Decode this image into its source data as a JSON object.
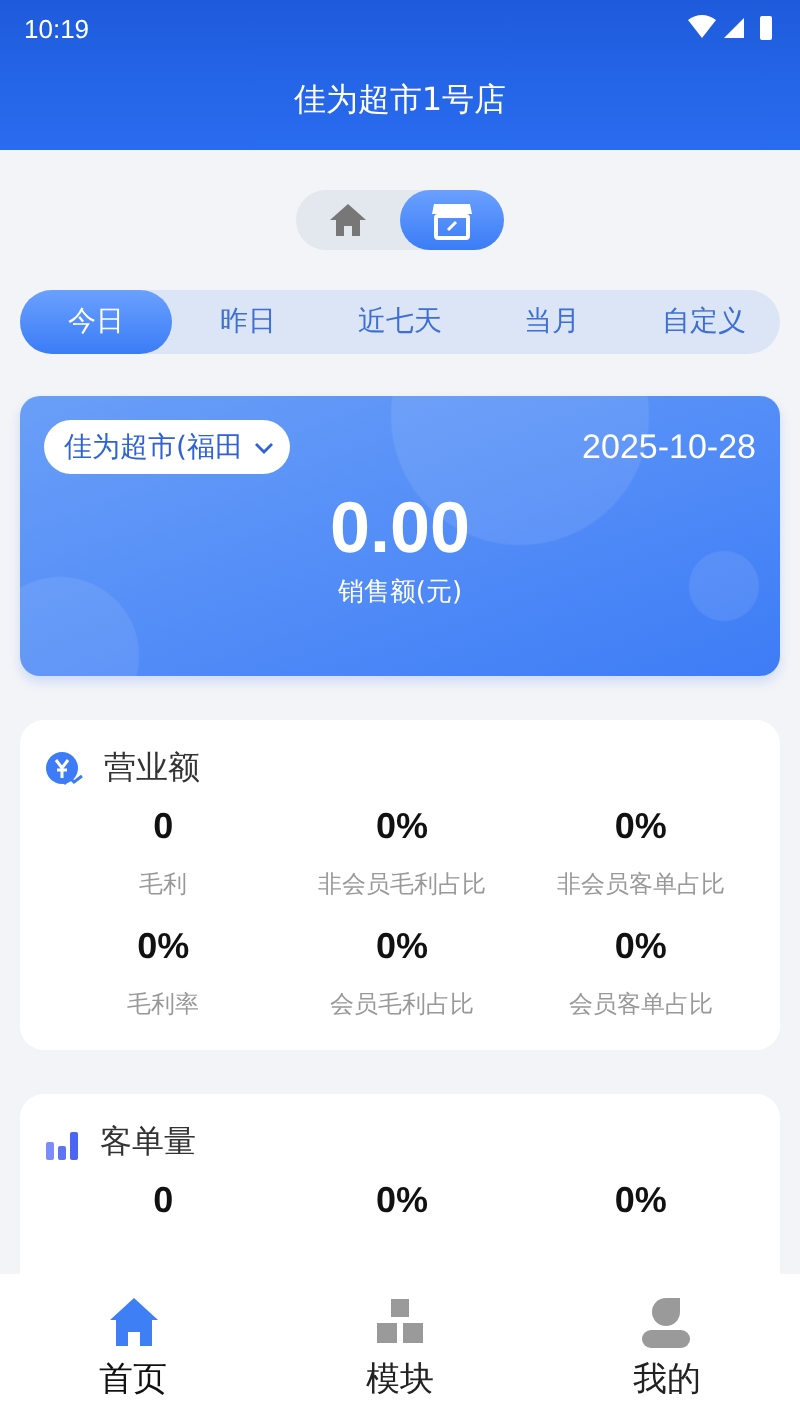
{
  "status_bar": {
    "time": "10:19"
  },
  "header": {
    "title": "佳为超市1号店"
  },
  "view_toggle": [
    {
      "kind": "home",
      "selected": false
    },
    {
      "kind": "store",
      "selected": true
    }
  ],
  "period_tabs": [
    {
      "label": "今日",
      "selected": true
    },
    {
      "label": "昨日",
      "selected": false
    },
    {
      "label": "近七天",
      "selected": false
    },
    {
      "label": "当月",
      "selected": false
    },
    {
      "label": "自定义",
      "selected": false
    }
  ],
  "summary": {
    "store": "佳为超市(福田",
    "date": "2025-10-28",
    "amount": "0.00",
    "caption": "销售额(元)"
  },
  "sections": [
    {
      "kind": "revenue",
      "title": "营业额",
      "stats": [
        {
          "value": "0",
          "label": "毛利"
        },
        {
          "value": "0%",
          "label": "非会员毛利占比"
        },
        {
          "value": "0%",
          "label": "非会员客单占比"
        },
        {
          "value": "0%",
          "label": "毛利率"
        },
        {
          "value": "0%",
          "label": "会员毛利占比"
        },
        {
          "value": "0%",
          "label": "会员客单占比"
        }
      ]
    },
    {
      "kind": "orders",
      "title": "客单量",
      "stats": [
        {
          "value": "0"
        },
        {
          "value": "0%"
        },
        {
          "value": "0%"
        }
      ]
    }
  ],
  "bottom_nav": [
    {
      "kind": "home",
      "label": "首页",
      "selected": true
    },
    {
      "kind": "modules",
      "label": "模块",
      "selected": false
    },
    {
      "kind": "profile",
      "label": "我的",
      "selected": false
    }
  ]
}
